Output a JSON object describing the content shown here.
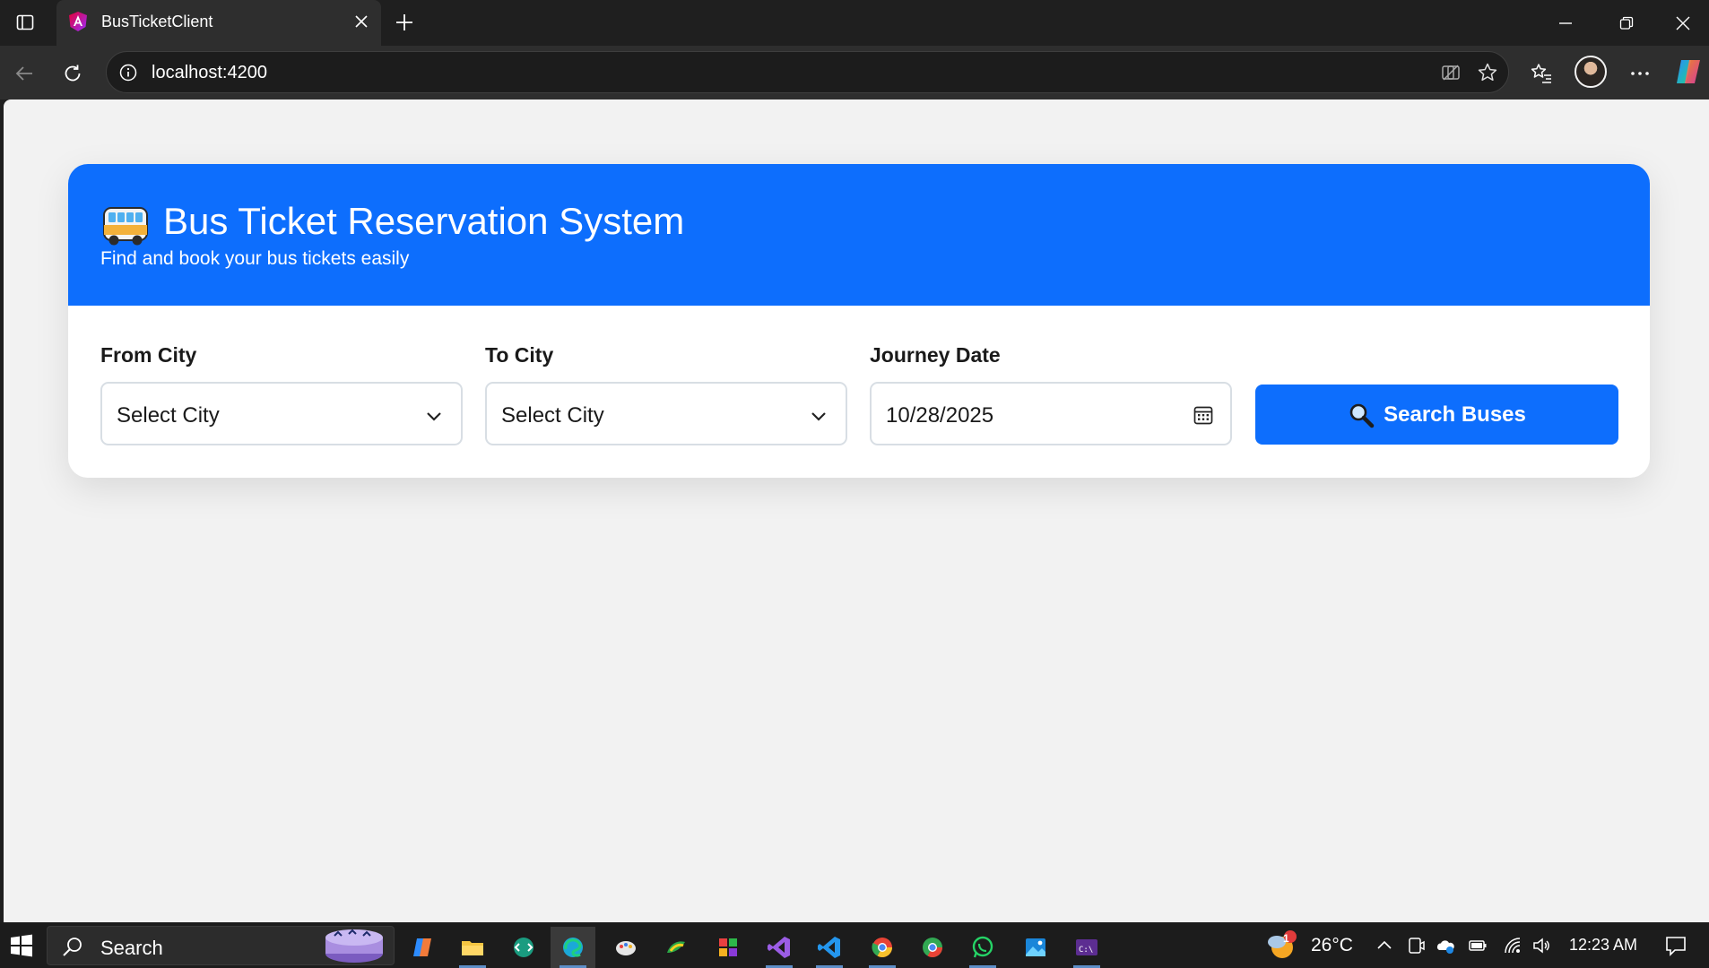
{
  "browser": {
    "tab": {
      "title": "BusTicketClient",
      "favicon": "angular-icon"
    },
    "url": "localhost:4200"
  },
  "page": {
    "header": {
      "icon": "bus-icon",
      "title": "Bus Ticket Reservation System",
      "subtitle": "Find and book your bus tickets easily"
    },
    "form": {
      "from_label": "From City",
      "from_value": "Select City",
      "to_label": "To City",
      "to_value": "Select City",
      "date_label": "Journey Date",
      "date_value": "10/28/2025",
      "search_label": "Search Buses",
      "search_icon": "magnifier-icon"
    },
    "colors": {
      "primary": "#0d6efd",
      "background": "#f2f2f2"
    }
  },
  "taskbar": {
    "search_placeholder": "Search",
    "weather_temp": "26°C",
    "weather_badge": "1",
    "time": "12:23 AM"
  }
}
